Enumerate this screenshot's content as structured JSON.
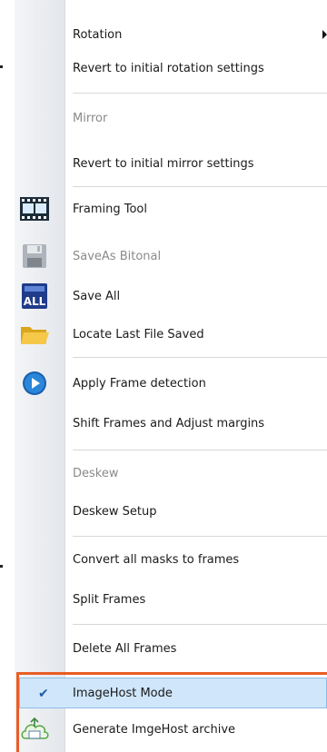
{
  "menu": {
    "items": [
      {
        "label": "Rotation",
        "disabled": false
      },
      {
        "label": "Revert to initial rotation settings",
        "disabled": false
      },
      {
        "label": "Mirror",
        "disabled": true
      },
      {
        "label": "Revert to initial mirror settings",
        "disabled": false
      },
      {
        "label": "Framing Tool",
        "disabled": false,
        "icon": "framing-tool-icon"
      },
      {
        "label": "SaveAs Bitonal",
        "disabled": true,
        "icon": "save-disk-icon"
      },
      {
        "label": "Save All",
        "disabled": false,
        "icon": "save-all-icon",
        "icon_text": "ALL"
      },
      {
        "label": "Locate Last File Saved",
        "disabled": false,
        "icon": "folder-icon"
      },
      {
        "label": "Apply Frame detection",
        "disabled": false,
        "icon": "play-circle-icon"
      },
      {
        "label": "Shift Frames and Adjust margins",
        "disabled": false
      },
      {
        "label": "Deskew",
        "disabled": true
      },
      {
        "label": "Deskew Setup",
        "disabled": false
      },
      {
        "label": "Convert all masks to frames",
        "disabled": false
      },
      {
        "label": "Split Frames",
        "disabled": false
      },
      {
        "label": "Delete All Frames",
        "disabled": false
      },
      {
        "label": "ImageHost Mode",
        "disabled": false,
        "checked": true,
        "icon": "checkmark-icon",
        "check_glyph": "✔"
      },
      {
        "label": "Generate ImgeHost archive",
        "disabled": false,
        "icon": "cloud-upload-icon"
      }
    ]
  },
  "colors": {
    "highlight_border": "#e85d25",
    "selection": "#cfe6fb",
    "disabled_text": "#8a8a8a"
  }
}
